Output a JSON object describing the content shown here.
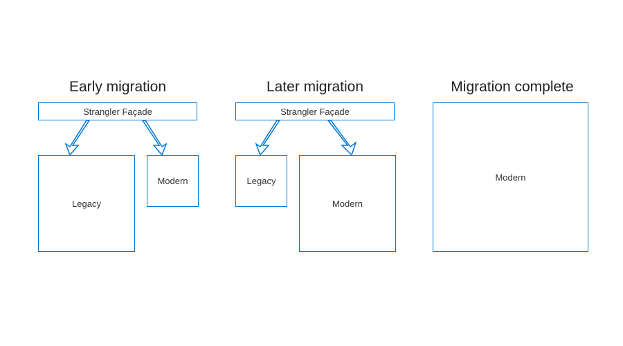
{
  "colors": {
    "border": "#0078d4",
    "text": "#222222",
    "background": "#ffffff"
  },
  "stages": {
    "early": {
      "title": "Early migration",
      "facade_label": "Strangler Façade",
      "legacy_label": "Legacy",
      "modern_label": "Modern"
    },
    "later": {
      "title": "Later migration",
      "facade_label": "Strangler Façade",
      "legacy_label": "Legacy",
      "modern_label": "Modern"
    },
    "complete": {
      "title": "Migration complete",
      "modern_label": "Modern"
    }
  }
}
